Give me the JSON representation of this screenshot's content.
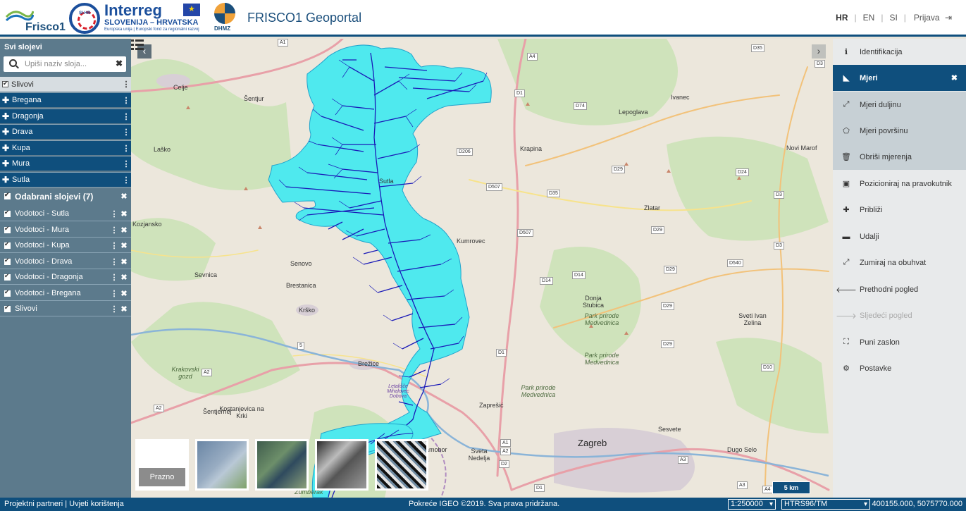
{
  "header": {
    "frisco_logo": "Frisco1",
    "interreg_name": "Interreg",
    "interreg_sub": "SLOVENIJA – HRVATSKA",
    "interreg_tiny": "Europska unija | Europski fond za regionalni razvoj",
    "interreg_badge": "SI-HR",
    "dhmz_logo": "DHMZ",
    "title": "FRISCO1 Geoportal",
    "languages": [
      "HR",
      "EN",
      "SI"
    ],
    "active_language": "HR",
    "login": "Prijava"
  },
  "left_panel": {
    "title": "Svi slojevi",
    "search_placeholder": "Upiši naziv sloja...",
    "all_layers": [
      "Slivovi",
      "Bregana",
      "Dragonja",
      "Drava",
      "Kupa",
      "Mura",
      "Sutla"
    ],
    "selected_title": "Odabrani slojevi (7)",
    "selected_layers": [
      "Vodotoci - Sutla",
      "Vodotoci - Mura",
      "Vodotoci - Kupa",
      "Vodotoci - Drava",
      "Vodotoci - Dragonja",
      "Vodotoci - Bregana",
      "Slivovi"
    ]
  },
  "map": {
    "places": [
      "Celje",
      "Šentjur",
      "Laško",
      "Senovo",
      "Sevnica",
      "Brestanica",
      "Krško",
      "Brežice",
      "Šentjernej",
      "Kostanjevica na Krki",
      "Samobor",
      "Sveta Nedelja",
      "Zaprešić",
      "Zagreb",
      "Sesvete",
      "Dugo Selo",
      "Krapina",
      "Zlatar",
      "Lepoglava",
      "Ivanec",
      "Novi Marof",
      "Donja Stubica",
      "Sveti Ivan Zelina",
      "Sutla",
      "Kumrovec",
      "Kozjansko"
    ],
    "parks": [
      "Park prirode Medvednica",
      "Park prirode Medvednica",
      "Park prirode Medvednica",
      "Krakovski gozd",
      "Letališče Mihalovec Dobova",
      "Žumberak"
    ],
    "roads": [
      "A1",
      "A1",
      "A4",
      "A2",
      "A2",
      "A2",
      "A3",
      "A3",
      "A4",
      "D1",
      "D1",
      "D1",
      "D2",
      "D3",
      "D3",
      "D3",
      "D14",
      "D14",
      "D24",
      "D29",
      "D29",
      "D29",
      "D29",
      "D29",
      "D35",
      "D35",
      "D74",
      "D206",
      "D507",
      "D507",
      "D540",
      "D10",
      "5"
    ],
    "basemaps": [
      "Prazno"
    ],
    "scale": "5 km"
  },
  "tools": {
    "items": [
      {
        "label": "Identifikacija",
        "icon": "info-icon"
      },
      {
        "label": "Mjeri",
        "icon": "measure-icon",
        "active": true
      },
      {
        "label": "Mjeri duljinu",
        "icon": "ruler-line-icon",
        "sub": true
      },
      {
        "label": "Mjeri površinu",
        "icon": "polygon-icon",
        "sub": true
      },
      {
        "label": "Obriši mjerenja",
        "icon": "trash-icon",
        "sub": true
      },
      {
        "label": "Pozicioniraj na pravokutnik",
        "icon": "rectangle-icon"
      },
      {
        "label": "Približi",
        "icon": "plus-icon"
      },
      {
        "label": "Udalji",
        "icon": "minus-icon"
      },
      {
        "label": "Zumiraj na obuhvat",
        "icon": "expand-icon"
      },
      {
        "label": "Prethodni pogled",
        "icon": "arrow-left-icon"
      },
      {
        "label": "Sljedeći pogled",
        "icon": "arrow-right-icon",
        "disabled": true
      },
      {
        "label": "Puni zaslon",
        "icon": "fullscreen-icon"
      },
      {
        "label": "Postavke",
        "icon": "gear-icon"
      }
    ]
  },
  "footer": {
    "partners": "Projektni partneri",
    "terms": "Uvjeti korištenja",
    "powered": "Pokreće IGEO ©2019. Sva prava pridržana.",
    "scale_select": "1:250000",
    "crs_select": "HTRS96/TM",
    "coordinates": "400155.000, 5075770.000"
  },
  "colors": {
    "primary": "#0f4f7d",
    "panel": "#5c7a8c",
    "basin_fill": "#4fe9ee",
    "river": "#1a1ab8"
  }
}
